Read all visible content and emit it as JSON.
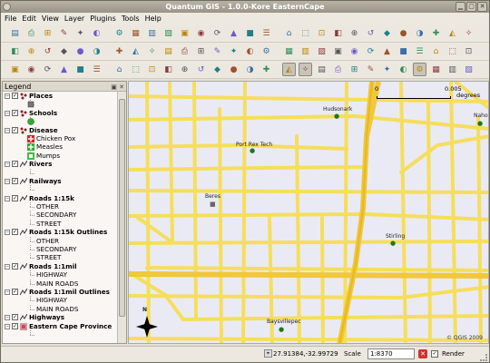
{
  "window": {
    "title": "Quantum GIS - 1.0.0-Kore  EasternCape",
    "minimize": "▁",
    "maximize": "▢",
    "close": "✕"
  },
  "menu": [
    "File",
    "Edit",
    "View",
    "Layer",
    "Plugins",
    "Tools",
    "Help"
  ],
  "toolbars": {
    "row1": [
      "new-project",
      "open-project",
      "save-project",
      "save-as",
      "print",
      "zoom-full",
      "zoom-layer",
      "zoom-last",
      "refresh",
      "map-tips",
      "add-vector",
      "add-raster",
      "add-postgis",
      "add-wms",
      "add-wfs",
      "overview-on",
      "overview-off",
      "overview-all",
      "plugin-a",
      "plugin-b",
      "plugin-c",
      "plugin-d",
      "plugin-e",
      "plugin-f",
      "plugin-g",
      "plugin-h",
      "plugin-i",
      "plugin-j"
    ],
    "row2": [
      "move-feature",
      "capture-point",
      "capture-line",
      "capture-polygon",
      "delete-part",
      "add-ring",
      "add-island",
      "split",
      "copy",
      "cut",
      "paste",
      "snap",
      "rotate",
      "node-tool",
      "vertex-add",
      "vertex-move",
      "vertex-delete",
      "merge",
      "cad",
      "georef",
      "delimit",
      "fill",
      "gps",
      "stat",
      "export",
      "grid",
      "toggle",
      "layout"
    ],
    "row3": [
      "select-a",
      "vertex-tool",
      "add-vertex",
      "move-vertex",
      "delete-vertex",
      "simplify",
      "edit",
      "undo",
      "redo",
      "split-features",
      "merge-features",
      "node",
      "offset",
      "reshape",
      "rotate-point",
      "pan",
      "zoom-in",
      "zoom-out",
      "zoom-full-2",
      "zoom-selection",
      "zoom-layer-2",
      "zoom-last-2",
      "identify",
      "measure",
      "measure-area",
      "bookmark",
      "tips",
      "help"
    ]
  },
  "legend": {
    "title": "Legend",
    "items": [
      {
        "label": "Places",
        "bold": true,
        "level": 0,
        "sym": "dots"
      },
      {
        "label": "",
        "level": 1,
        "sym": "square-gray"
      },
      {
        "label": "Schools",
        "bold": true,
        "level": 0,
        "sym": "dots"
      },
      {
        "label": "",
        "level": 1,
        "sym": "green-circle"
      },
      {
        "label": "Disease",
        "bold": true,
        "level": 0,
        "sym": "dots"
      },
      {
        "label": "Chicken Pox",
        "level": 1,
        "sym": "red-plus"
      },
      {
        "label": "Measles",
        "level": 1,
        "sym": "green-plus"
      },
      {
        "label": "Mumps",
        "level": 1,
        "sym": "green-square"
      },
      {
        "label": "Rivers",
        "bold": true,
        "level": 0,
        "sym": "line"
      },
      {
        "label": "",
        "level": 1,
        "sym": "none"
      },
      {
        "label": "Railways",
        "bold": true,
        "level": 0,
        "sym": "line"
      },
      {
        "label": "",
        "level": 1,
        "sym": "none"
      },
      {
        "label": "Roads 1:15k",
        "bold": true,
        "level": 0,
        "sym": "line"
      },
      {
        "label": "OTHER",
        "level": 1,
        "sym": "none"
      },
      {
        "label": "SECONDARY",
        "level": 1,
        "sym": "none"
      },
      {
        "label": "STREET",
        "level": 1,
        "sym": "none"
      },
      {
        "label": "Roads 1:15k Outlines",
        "bold": true,
        "level": 0,
        "sym": "line"
      },
      {
        "label": "OTHER",
        "level": 1,
        "sym": "none"
      },
      {
        "label": "SECONDARY",
        "level": 1,
        "sym": "none"
      },
      {
        "label": "STREET",
        "level": 1,
        "sym": "none"
      },
      {
        "label": "Roads 1:1mil",
        "bold": true,
        "level": 0,
        "sym": "line"
      },
      {
        "label": "HIGHWAY",
        "level": 1,
        "sym": "none"
      },
      {
        "label": "MAIN ROADS",
        "level": 1,
        "sym": "none"
      },
      {
        "label": "Roads 1:1mil Outlines",
        "bold": true,
        "level": 0,
        "sym": "line"
      },
      {
        "label": "HIGHWAY",
        "level": 1,
        "sym": "none"
      },
      {
        "label": "MAIN ROADS",
        "level": 1,
        "sym": "none"
      },
      {
        "label": "Highways",
        "bold": true,
        "level": 0,
        "sym": "line"
      },
      {
        "label": "Eastern Cape Province",
        "bold": true,
        "level": 0,
        "sym": "province"
      },
      {
        "label": "",
        "level": 1,
        "sym": "none"
      }
    ]
  },
  "map": {
    "background": "#eaeaf5",
    "road_color": "#f5de5c",
    "scale_left": "0",
    "scale_right": "0.005",
    "scale_unit": "degrees",
    "copyright": "© QGIS 2009",
    "north": "N",
    "places": [
      {
        "name": "Hudsonark",
        "icon": "school"
      },
      {
        "name": "Port Rex Tech",
        "icon": "school"
      },
      {
        "name": "Beres",
        "icon": "place"
      },
      {
        "name": "Stirling",
        "icon": "school"
      },
      {
        "name": "Baysvillepec",
        "icon": "school"
      },
      {
        "name": "Naho",
        "icon": "school"
      }
    ]
  },
  "status": {
    "coordinates": "27.91384,-32.99729",
    "scale_label": "Scale",
    "scale_value": "1:8370",
    "render_label": "Render",
    "render_checked": true
  }
}
